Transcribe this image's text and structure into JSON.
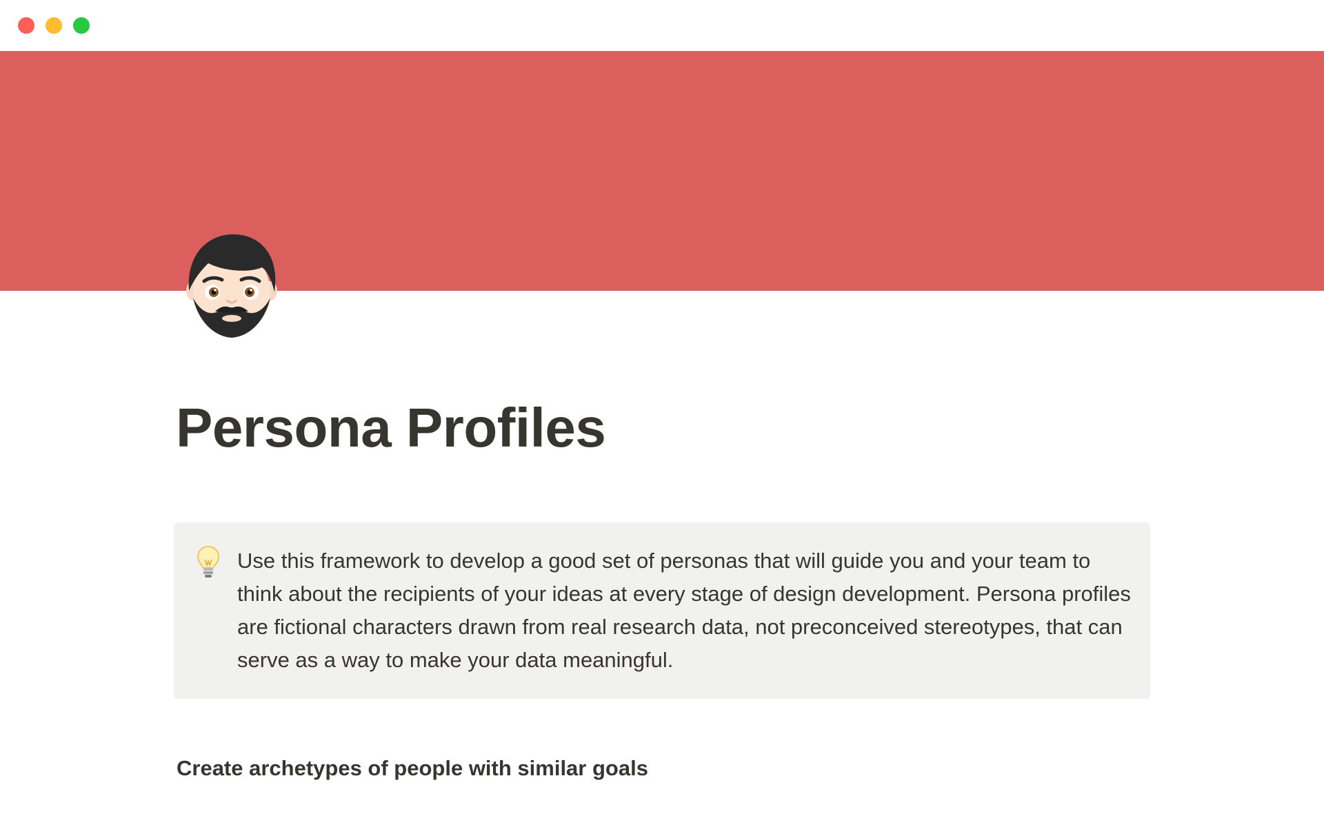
{
  "window": {
    "controls": [
      "close",
      "minimize",
      "zoom"
    ],
    "colors": {
      "close": "#ff5f57",
      "minimize": "#febc2e",
      "zoom": "#28c840"
    }
  },
  "cover": {
    "color": "#db5f5c"
  },
  "page": {
    "icon": "bearded-man-emoji-icon",
    "title": "Persona Profiles"
  },
  "callout": {
    "icon": "lightbulb-icon",
    "text": "Use this framework to develop a good set of personas that will guide you and your team to think about the recipients of your ideas at every stage of design development. Persona profiles are fictional characters drawn from real research data, not preconceived stereotypes, that can serve as a way to make your data meaningful.",
    "background": "#f1f1ef"
  },
  "section": {
    "heading": "Create archetypes of people with similar goals"
  }
}
